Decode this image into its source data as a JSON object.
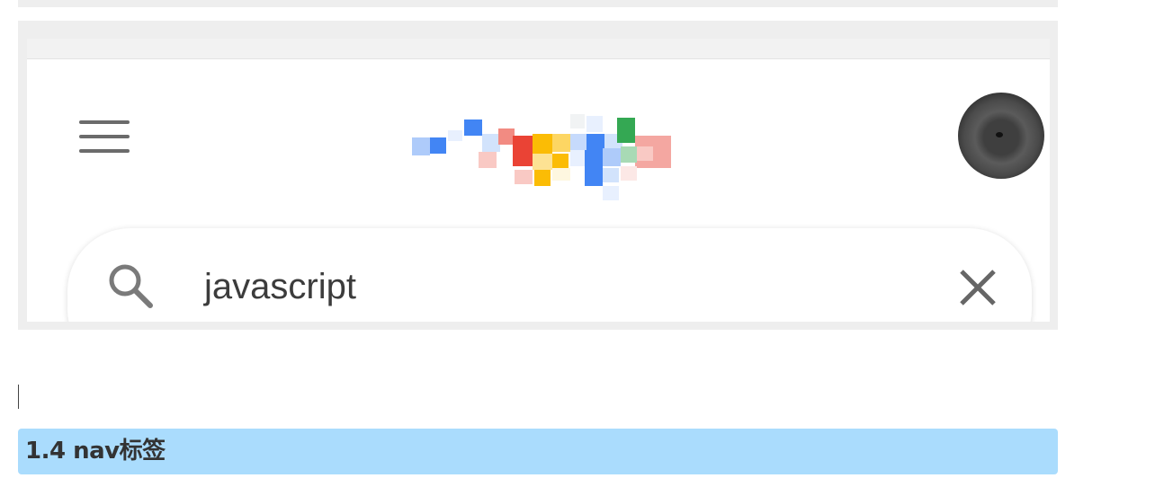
{
  "embedded_screenshot": {
    "search": {
      "query": "javascript",
      "icon": "search-icon"
    },
    "menu_icon": "hamburger-menu-icon",
    "clear_icon": "close-icon",
    "logo_description": "pixelated-logo",
    "avatar": "user-avatar"
  },
  "section_heading": {
    "text": "1.4 nav标签"
  },
  "colors": {
    "heading_background": "#aadcfd",
    "frame_border": "#eeeeee",
    "logo_blue": "#4285f4",
    "logo_red": "#ea4335",
    "logo_yellow": "#fbbc05",
    "logo_green": "#34a853"
  }
}
